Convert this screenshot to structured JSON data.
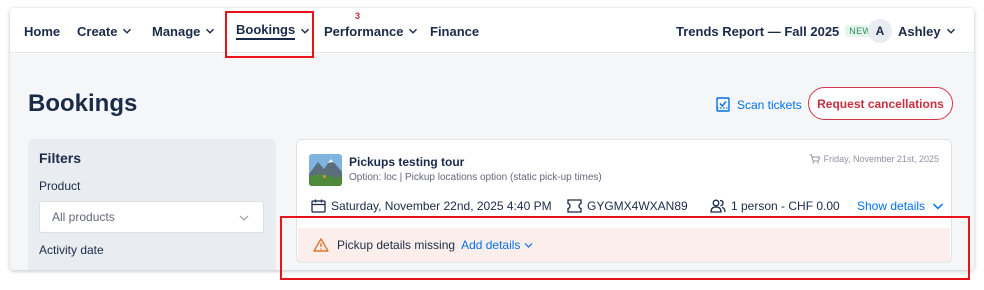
{
  "nav": {
    "home": "Home",
    "create": "Create",
    "manage": "Manage",
    "bookings": "Bookings",
    "performance": "Performance",
    "performance_count": "3",
    "finance": "Finance",
    "trends_report": "Trends Report — Fall 2025",
    "new_badge": "NEW",
    "user_initial": "A",
    "user_name": "Ashley"
  },
  "page": {
    "title": "Bookings",
    "scan_tickets": "Scan tickets",
    "request_cancellations": "Request cancellations"
  },
  "filters": {
    "title": "Filters",
    "product_label": "Product",
    "product_value": "All products",
    "activity_date_label": "Activity date"
  },
  "booking": {
    "tour_title": "Pickups testing tour",
    "option": "Option: loc | Pickup locations option (static pick-up times)",
    "purchase_date": "Friday, November 21st, 2025",
    "activity_datetime": "Saturday, November 22nd, 2025 4:40 PM",
    "reference": "GYGMX4WXAN89",
    "participants_price": "1 person - CHF 0.00",
    "show_details": "Show details",
    "alert_text": "Pickup details missing",
    "add_details": "Add details"
  },
  "colors": {
    "primary_text": "#1a2b49",
    "link_blue": "#0071eb",
    "danger_red": "#c9303f",
    "alert_bg": "#fcefeb",
    "warning_orange": "#e0752f",
    "annotation_red": "#e8131a"
  },
  "icons": [
    "chevron-down-icon",
    "ticket-scan-icon",
    "shopping-cart-icon",
    "calendar-icon",
    "ticket-icon",
    "people-icon",
    "warning-icon",
    "tour-thumbnail"
  ]
}
